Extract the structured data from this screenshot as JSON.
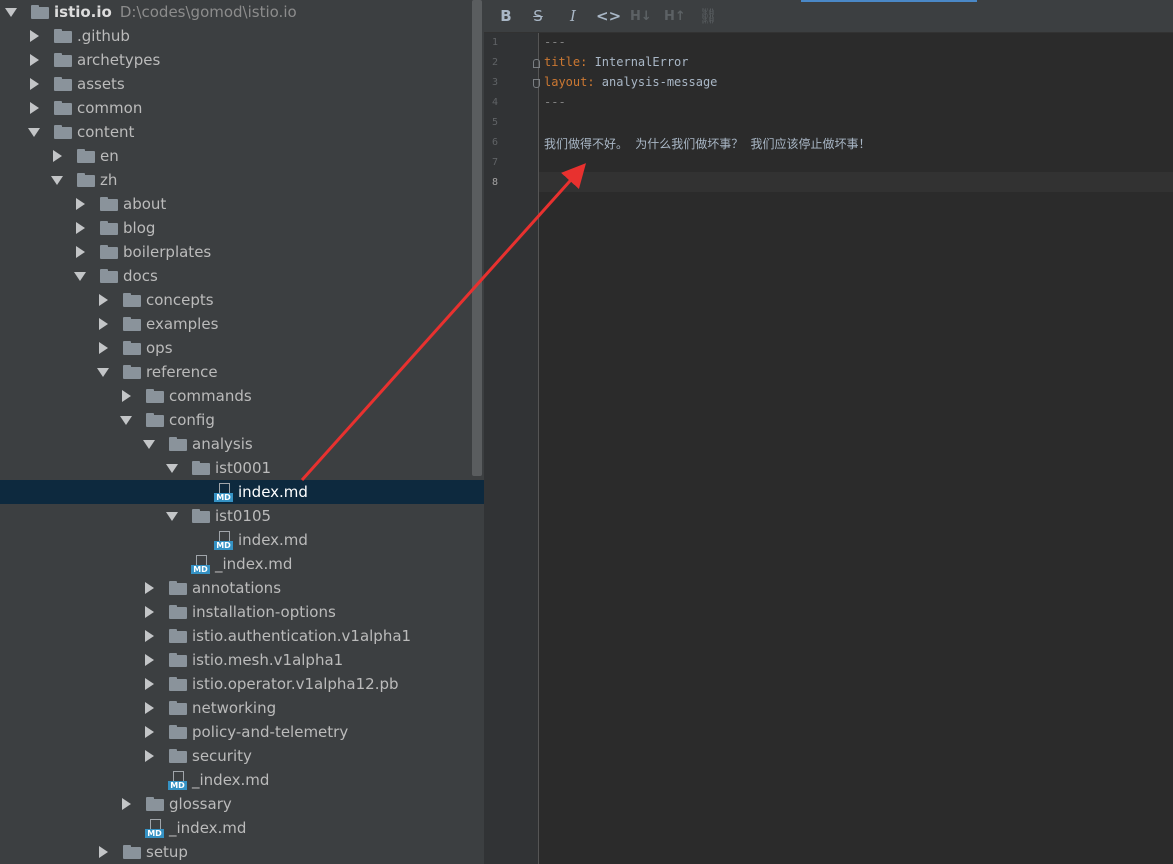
{
  "tree": {
    "root": {
      "label": "istio.io",
      "path": "D:\\codes\\gomod\\istio.io"
    },
    "items": [
      {
        "label": ".github",
        "depth": 1,
        "kind": "folder",
        "state": "collapsed"
      },
      {
        "label": "archetypes",
        "depth": 1,
        "kind": "folder",
        "state": "collapsed"
      },
      {
        "label": "assets",
        "depth": 1,
        "kind": "folder",
        "state": "collapsed"
      },
      {
        "label": "common",
        "depth": 1,
        "kind": "folder",
        "state": "collapsed"
      },
      {
        "label": "content",
        "depth": 1,
        "kind": "folder",
        "state": "expanded"
      },
      {
        "label": "en",
        "depth": 2,
        "kind": "folder",
        "state": "collapsed"
      },
      {
        "label": "zh",
        "depth": 2,
        "kind": "folder",
        "state": "expanded"
      },
      {
        "label": "about",
        "depth": 3,
        "kind": "folder",
        "state": "collapsed"
      },
      {
        "label": "blog",
        "depth": 3,
        "kind": "folder",
        "state": "collapsed"
      },
      {
        "label": "boilerplates",
        "depth": 3,
        "kind": "folder",
        "state": "collapsed"
      },
      {
        "label": "docs",
        "depth": 3,
        "kind": "folder",
        "state": "expanded"
      },
      {
        "label": "concepts",
        "depth": 4,
        "kind": "folder",
        "state": "collapsed"
      },
      {
        "label": "examples",
        "depth": 4,
        "kind": "folder",
        "state": "collapsed"
      },
      {
        "label": "ops",
        "depth": 4,
        "kind": "folder",
        "state": "collapsed"
      },
      {
        "label": "reference",
        "depth": 4,
        "kind": "folder",
        "state": "expanded"
      },
      {
        "label": "commands",
        "depth": 5,
        "kind": "folder",
        "state": "collapsed"
      },
      {
        "label": "config",
        "depth": 5,
        "kind": "folder",
        "state": "expanded"
      },
      {
        "label": "analysis",
        "depth": 6,
        "kind": "folder",
        "state": "expanded"
      },
      {
        "label": "ist0001",
        "depth": 7,
        "kind": "folder",
        "state": "expanded"
      },
      {
        "label": "index.md",
        "depth": 8,
        "kind": "md",
        "state": "none",
        "selected": true
      },
      {
        "label": "ist0105",
        "depth": 7,
        "kind": "folder",
        "state": "expanded"
      },
      {
        "label": "index.md",
        "depth": 8,
        "kind": "md",
        "state": "none"
      },
      {
        "label": "_index.md",
        "depth": 7,
        "kind": "md",
        "state": "none"
      },
      {
        "label": "annotations",
        "depth": 6,
        "kind": "folder",
        "state": "collapsed"
      },
      {
        "label": "installation-options",
        "depth": 6,
        "kind": "folder",
        "state": "collapsed"
      },
      {
        "label": "istio.authentication.v1alpha1",
        "depth": 6,
        "kind": "folder",
        "state": "collapsed"
      },
      {
        "label": "istio.mesh.v1alpha1",
        "depth": 6,
        "kind": "folder",
        "state": "collapsed"
      },
      {
        "label": "istio.operator.v1alpha12.pb",
        "depth": 6,
        "kind": "folder",
        "state": "collapsed"
      },
      {
        "label": "networking",
        "depth": 6,
        "kind": "folder",
        "state": "collapsed"
      },
      {
        "label": "policy-and-telemetry",
        "depth": 6,
        "kind": "folder",
        "state": "collapsed"
      },
      {
        "label": "security",
        "depth": 6,
        "kind": "folder",
        "state": "collapsed"
      },
      {
        "label": "_index.md",
        "depth": 6,
        "kind": "md",
        "state": "none"
      },
      {
        "label": "glossary",
        "depth": 5,
        "kind": "folder",
        "state": "collapsed"
      },
      {
        "label": "_index.md",
        "depth": 5,
        "kind": "md",
        "state": "none"
      },
      {
        "label": "setup",
        "depth": 4,
        "kind": "folder",
        "state": "collapsed"
      }
    ],
    "md_badge": "MD"
  },
  "toolbar": {
    "bold": "B",
    "strikethrough": "S",
    "italic": "I",
    "code": "<>",
    "header_down": "H↓",
    "header_up": "H↑",
    "link": "⛓"
  },
  "editor": {
    "current_line": "8",
    "lines": [
      {
        "number": "1",
        "text": "---"
      },
      {
        "number": "2",
        "key": "title:",
        "value": " InternalError"
      },
      {
        "number": "3",
        "key": "layout:",
        "value": " analysis-message"
      },
      {
        "number": "4",
        "text": "---"
      },
      {
        "number": "5",
        "text": ""
      },
      {
        "number": "6",
        "text": "我们做得不好。 为什么我们做坏事？ 我们应该停止做坏事！"
      },
      {
        "number": "7",
        "text": ""
      },
      {
        "number": "8",
        "text": ""
      }
    ]
  },
  "annotation": {
    "color": "#e8312f"
  }
}
